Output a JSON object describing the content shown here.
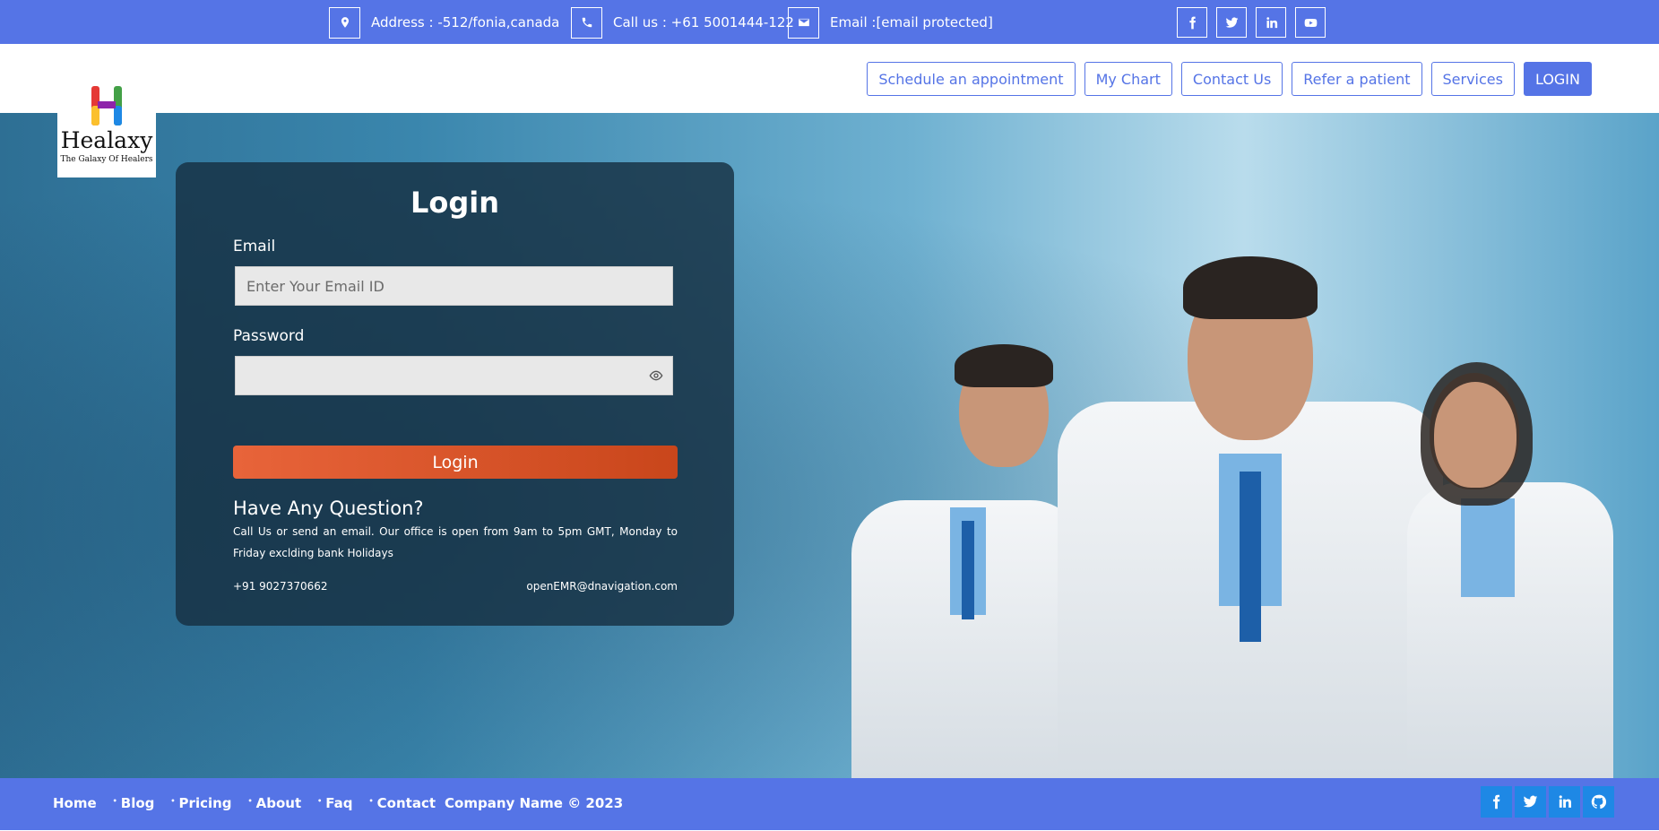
{
  "topbar": {
    "address": "Address : -512/fonia,canada",
    "phone": "Call us : +61 5001444-122",
    "email": "Email :[email protected]"
  },
  "brand": {
    "name": "Healaxy",
    "tagline": "The Galaxy Of Healers"
  },
  "nav": {
    "schedule": "Schedule an appointment",
    "mychart": "My Chart",
    "contact": "Contact Us",
    "refer": "Refer a patient",
    "services": "Services",
    "login": "LOGIN"
  },
  "login": {
    "title": "Login",
    "email_label": "Email",
    "email_placeholder": "Enter Your Email ID",
    "password_label": "Password",
    "submit": "Login"
  },
  "question": {
    "title": "Have Any Question?",
    "text": "Call Us or send an email. Our office is open from 9am to 5pm GMT, Monday to Friday exclding bank Holidays",
    "phone": "+91 9027370662",
    "email": "openEMR@dnavigation.com"
  },
  "footer": {
    "links": [
      "Home",
      "Blog",
      "Pricing",
      "About",
      "Faq",
      "Contact"
    ],
    "copyright": "Company Name © 2023"
  },
  "colors": {
    "primary": "#5574e6",
    "login_button": "#e05a2b",
    "social": "#1e88e5"
  }
}
